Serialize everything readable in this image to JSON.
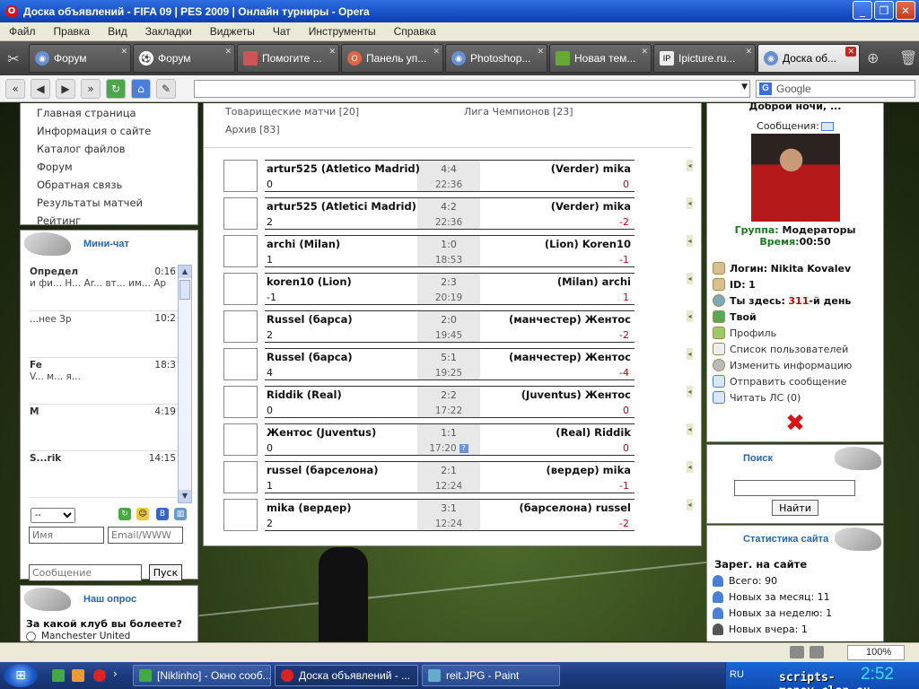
{
  "window": {
    "title": "Доска объявлений - FIFA 09 | PES 2009 | Онлайн турниры - Opera"
  },
  "menu": [
    "Файл",
    "Правка",
    "Вид",
    "Закладки",
    "Виджеты",
    "Чат",
    "Инструменты",
    "Справка"
  ],
  "tabs": [
    {
      "label": "Форум",
      "active": false
    },
    {
      "label": "Форум",
      "active": false
    },
    {
      "label": "Помогите ...",
      "active": false
    },
    {
      "label": "Панель уп...",
      "active": false
    },
    {
      "label": "Photoshop...",
      "active": false
    },
    {
      "label": "Новая тем...",
      "active": false
    },
    {
      "label": "Ipicture.ru...",
      "active": false
    },
    {
      "label": "Доска об...",
      "active": true
    }
  ],
  "search": {
    "engine": "Google"
  },
  "left_nav": [
    "Главная страница",
    "Информация о сайте",
    "Каталог файлов",
    "Форум",
    "Обратная связь",
    "Результаты матчей",
    "Рейтинг"
  ],
  "minichat": {
    "title": "Мини-чат",
    "messages": [
      {
        "name": "Определ",
        "time": "0:16",
        "body": "и фи... Н... Ar... вт... им... Ар"
      },
      {
        "name": "",
        "time": "10:2",
        "body": "...нее Зр"
      },
      {
        "name": "Fe",
        "time": "18:3",
        "body": "V... м... я..."
      },
      {
        "name": "M",
        "time": "4:19",
        "body": ""
      },
      {
        "name": "S...rik",
        "time": "14:15",
        "body": ""
      }
    ],
    "select_value": "--",
    "name_placeholder": "Имя",
    "email_placeholder": "Email/WWW",
    "message_placeholder": "Сообщение",
    "send_label": "Пуск"
  },
  "poll": {
    "title": "Наш опрос",
    "question": "За какой клуб вы болеете?",
    "options": [
      "Manchester United"
    ]
  },
  "categories": {
    "friendly": "Товарищеские матчи [20]",
    "champions": "Лига Чемпионов [23]",
    "archive": "Архив [83]"
  },
  "matches": [
    {
      "p1": "artur525 (Atletico Madrid)",
      "s1": "0",
      "score": "4:4",
      "time": "22:36",
      "p2": "(Verder) mika",
      "s2": "0",
      "q": false
    },
    {
      "p1": "artur525 (Atletici Madrid)",
      "s1": "2",
      "score": "4:2",
      "time": "22:36",
      "p2": "(Verder) mika",
      "s2": "-2",
      "q": false
    },
    {
      "p1": "archi (Milan)",
      "s1": "1",
      "score": "1:0",
      "time": "18:53",
      "p2": "(Lion) Koren10",
      "s2": "-1",
      "q": false
    },
    {
      "p1": "koren10 (Lion)",
      "s1": "-1",
      "score": "2:3",
      "time": "20:19",
      "p2": "(Milan) archi",
      "s2": "1",
      "q": false
    },
    {
      "p1": "Russel (барса)",
      "s1": "2",
      "score": "2:0",
      "time": "19:45",
      "p2": "(манчестер) Жентос",
      "s2": "-2",
      "q": false
    },
    {
      "p1": "Russel (барса)",
      "s1": "4",
      "score": "5:1",
      "time": "19:25",
      "p2": "(манчестер) Жентос",
      "s2": "-4",
      "q": false
    },
    {
      "p1": "Riddik (Real)",
      "s1": "0",
      "score": "2:2",
      "time": "17:22",
      "p2": "(Juventus) Жентос",
      "s2": "0",
      "q": false
    },
    {
      "p1": "Жентос (Juventus)",
      "s1": "0",
      "score": "1:1",
      "time": "17:20",
      "p2": "(Real) Riddik",
      "s2": "0",
      "q": true
    },
    {
      "p1": "russel (барселона)",
      "s1": "1",
      "score": "2:1",
      "time": "12:24",
      "p2": "(вердер) mika",
      "s2": "-1",
      "q": false
    },
    {
      "p1": "mika (вердер)",
      "s1": "2",
      "score": "3:1",
      "time": "12:24",
      "p2": "(барселона) russel",
      "s2": "-2",
      "q": false
    }
  ],
  "user": {
    "greeting": "Доброй ночи, ...",
    "messages_label": "Сообщения:",
    "group_label": "Группа:",
    "group_value": "Модераторы",
    "time_label": "Время:",
    "time_value": "00:50",
    "login_label": "Логин:",
    "login_value": "Nikita Kovalev",
    "id_label": "ID:",
    "id_value": "1",
    "here_prefix": "Ты здесь:",
    "here_days": "311",
    "here_suffix": "-й день",
    "yours_label": "Твой",
    "links": [
      "Профиль",
      "Список пользователей",
      "Изменить информацию",
      "Отправить сообщение",
      "Читать ЛС (0)"
    ]
  },
  "search_block": {
    "title": "Поиск",
    "button": "Найти"
  },
  "stats": {
    "title": "Статистика сайта",
    "registered_title": "Зарег. на сайте",
    "total": "Всего: 90",
    "month": "Новых за месяц: 11",
    "week": "Новых за неделю: 1",
    "yesterday": "Новых вчера: 1"
  },
  "statusbar": {
    "zoom": "100%"
  },
  "taskbar": {
    "items": [
      {
        "label": "[Niklinho] - Окно сооб...",
        "active": false
      },
      {
        "label": "Доска объявлений - ...",
        "active": true
      },
      {
        "label": "reit.JPG - Paint",
        "active": false
      }
    ],
    "lang": "RU",
    "clock": "2:52"
  },
  "watermark": "scripts-money.clan.su"
}
